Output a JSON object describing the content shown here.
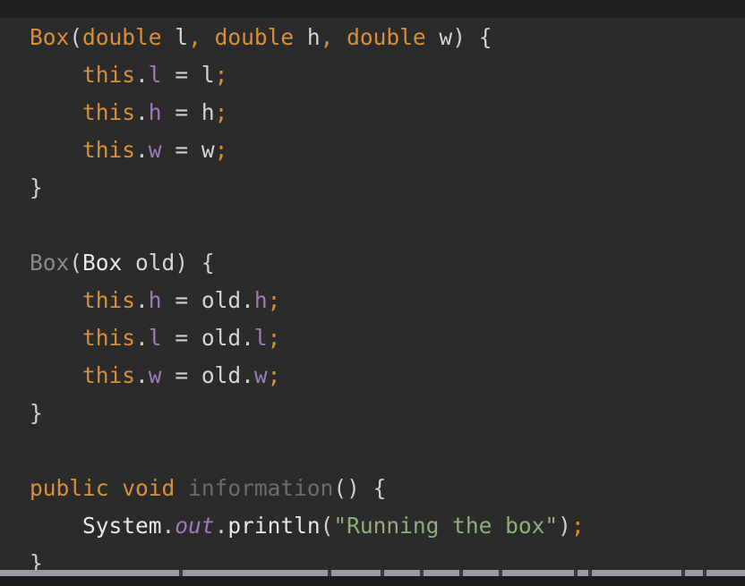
{
  "editor": {
    "language": "Java",
    "lines": [
      {
        "tokens": [
          {
            "t": "Box",
            "c": "kw"
          },
          {
            "t": "(",
            "c": "punct"
          },
          {
            "t": "double",
            "c": "kw"
          },
          {
            "t": " l",
            "c": "param"
          },
          {
            "t": ",",
            "c": "kw"
          },
          {
            "t": " ",
            "c": "punct"
          },
          {
            "t": "double",
            "c": "kw"
          },
          {
            "t": " h",
            "c": "param"
          },
          {
            "t": ",",
            "c": "kw"
          },
          {
            "t": " ",
            "c": "punct"
          },
          {
            "t": "double",
            "c": "kw"
          },
          {
            "t": " w",
            "c": "param"
          },
          {
            "t": ") {",
            "c": "punct"
          }
        ]
      },
      {
        "tokens": [
          {
            "t": "    ",
            "c": "punct"
          },
          {
            "t": "this",
            "c": "kw"
          },
          {
            "t": ".",
            "c": "punct"
          },
          {
            "t": "l",
            "c": "field"
          },
          {
            "t": " = ",
            "c": "punct"
          },
          {
            "t": "l",
            "c": "param"
          },
          {
            "t": ";",
            "c": "semi"
          }
        ]
      },
      {
        "tokens": [
          {
            "t": "    ",
            "c": "punct"
          },
          {
            "t": "this",
            "c": "kw"
          },
          {
            "t": ".",
            "c": "punct"
          },
          {
            "t": "h",
            "c": "field"
          },
          {
            "t": " = ",
            "c": "punct"
          },
          {
            "t": "h",
            "c": "param"
          },
          {
            "t": ";",
            "c": "semi"
          }
        ]
      },
      {
        "tokens": [
          {
            "t": "    ",
            "c": "punct"
          },
          {
            "t": "this",
            "c": "kw"
          },
          {
            "t": ".",
            "c": "punct"
          },
          {
            "t": "w",
            "c": "field"
          },
          {
            "t": " = ",
            "c": "punct"
          },
          {
            "t": "w",
            "c": "param"
          },
          {
            "t": ";",
            "c": "semi"
          }
        ]
      },
      {
        "tokens": [
          {
            "t": "}",
            "c": "punct"
          }
        ]
      },
      {
        "tokens": []
      },
      {
        "tokens": [
          {
            "t": "Box",
            "c": "cls-dim"
          },
          {
            "t": "(",
            "c": "punct"
          },
          {
            "t": "Box",
            "c": "cls"
          },
          {
            "t": " old",
            "c": "param"
          },
          {
            "t": ") {",
            "c": "punct"
          }
        ]
      },
      {
        "tokens": [
          {
            "t": "    ",
            "c": "punct"
          },
          {
            "t": "this",
            "c": "kw"
          },
          {
            "t": ".",
            "c": "punct"
          },
          {
            "t": "h",
            "c": "field"
          },
          {
            "t": " = ",
            "c": "punct"
          },
          {
            "t": "old",
            "c": "param"
          },
          {
            "t": ".",
            "c": "punct"
          },
          {
            "t": "h",
            "c": "field"
          },
          {
            "t": ";",
            "c": "semi"
          }
        ]
      },
      {
        "tokens": [
          {
            "t": "    ",
            "c": "punct"
          },
          {
            "t": "this",
            "c": "kw"
          },
          {
            "t": ".",
            "c": "punct"
          },
          {
            "t": "l",
            "c": "field"
          },
          {
            "t": " = ",
            "c": "punct"
          },
          {
            "t": "old",
            "c": "param"
          },
          {
            "t": ".",
            "c": "punct"
          },
          {
            "t": "l",
            "c": "field"
          },
          {
            "t": ";",
            "c": "semi"
          }
        ]
      },
      {
        "tokens": [
          {
            "t": "    ",
            "c": "punct"
          },
          {
            "t": "this",
            "c": "kw"
          },
          {
            "t": ".",
            "c": "punct"
          },
          {
            "t": "w",
            "c": "field"
          },
          {
            "t": " = ",
            "c": "punct"
          },
          {
            "t": "old",
            "c": "param"
          },
          {
            "t": ".",
            "c": "punct"
          },
          {
            "t": "w",
            "c": "field"
          },
          {
            "t": ";",
            "c": "semi"
          }
        ]
      },
      {
        "tokens": [
          {
            "t": "}",
            "c": "punct"
          }
        ]
      },
      {
        "tokens": []
      },
      {
        "tokens": [
          {
            "t": "public",
            "c": "kw"
          },
          {
            "t": " ",
            "c": "punct"
          },
          {
            "t": "void",
            "c": "kw"
          },
          {
            "t": " ",
            "c": "punct"
          },
          {
            "t": "information",
            "c": "method-dim"
          },
          {
            "t": "() {",
            "c": "punct"
          }
        ]
      },
      {
        "tokens": [
          {
            "t": "    ",
            "c": "punct"
          },
          {
            "t": "System",
            "c": "cls"
          },
          {
            "t": ".",
            "c": "punct"
          },
          {
            "t": "out",
            "c": "static-field"
          },
          {
            "t": ".",
            "c": "punct"
          },
          {
            "t": "println",
            "c": "cls"
          },
          {
            "t": "(",
            "c": "punct"
          },
          {
            "t": "\"Running the box\"",
            "c": "str"
          },
          {
            "t": ")",
            "c": "punct"
          },
          {
            "t": ";",
            "c": "semi"
          }
        ]
      },
      {
        "tokens": [
          {
            "t": "}",
            "c": "punct"
          }
        ]
      }
    ]
  },
  "colors": {
    "background": "#2b2b2b",
    "keyword": "#d78f3a",
    "field": "#9c7bb8",
    "string": "#8fae7a",
    "text": "#d4d4d4"
  }
}
